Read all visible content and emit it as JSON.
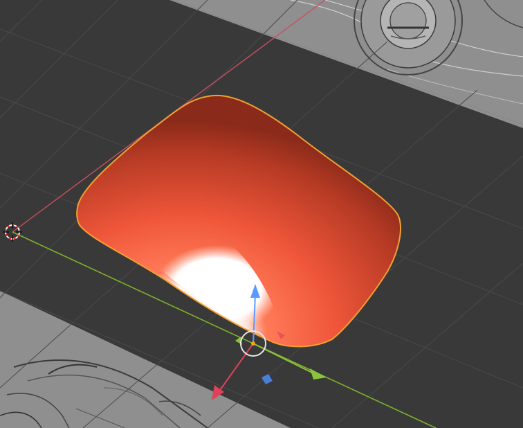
{
  "viewport": {
    "view": "3d-viewport",
    "background_color": "#393939",
    "grid_color": "#4a4a4a",
    "reference_image_color": "#8f8f8f"
  },
  "axes": {
    "x_axis_color": "#c85060",
    "y_axis_color": "#7fb22a"
  },
  "selected_object": {
    "type": "curved-surface-mesh",
    "base_color": "#e8523a",
    "highlight_color": "#ffffff",
    "outline_color": "#f5a030",
    "selected": true
  },
  "gizmo": {
    "type": "transform-gizmo",
    "x_color": "#e0405a",
    "y_color": "#8ac43a",
    "z_color": "#5a9aff",
    "plane_handle_color": "#4a7fd8",
    "center_ring_color": "#e6e6e6",
    "origin_color": "#f0a020"
  },
  "cursor": {
    "type": "3d-cursor",
    "colors": [
      "#ff3030",
      "#ffffff"
    ]
  }
}
